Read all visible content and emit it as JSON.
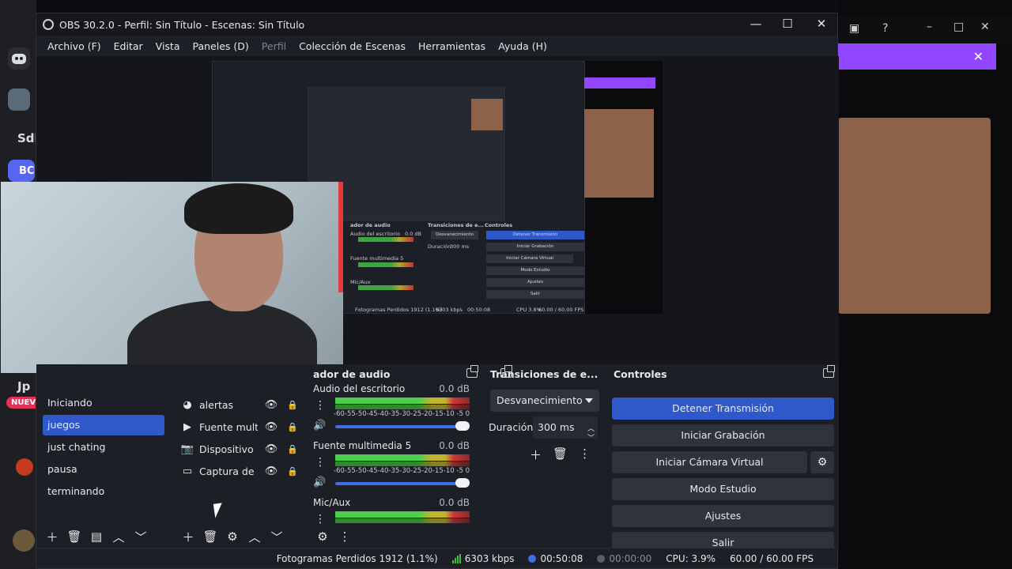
{
  "window": {
    "title": "OBS 30.2.0 - Perfil: Sin Título - Escenas: Sin Título"
  },
  "menu": [
    {
      "label": "Archivo (F)",
      "disabled": false
    },
    {
      "label": "Editar",
      "disabled": false
    },
    {
      "label": "Vista",
      "disabled": false
    },
    {
      "label": "Paneles (D)",
      "disabled": false
    },
    {
      "label": "Perfil",
      "disabled": true
    },
    {
      "label": "Colección de Escenas",
      "disabled": false
    },
    {
      "label": "Herramientas",
      "disabled": false
    },
    {
      "label": "Ayuda (H)",
      "disabled": false
    }
  ],
  "background": {
    "left_text_1": "Sdl",
    "left_text_2": "BC",
    "left_text_3": "Jp",
    "left_badge": "NUEV"
  },
  "scenes": {
    "items": [
      "Iniciando",
      "juegos",
      "just chating",
      "pausa",
      "terminando"
    ],
    "active_index": 1
  },
  "sources": {
    "items": [
      {
        "icon": "alerts-icon",
        "label": "alertas"
      },
      {
        "icon": "play-icon",
        "label": "Fuente mult"
      },
      {
        "icon": "camera-icon",
        "label": "Dispositivo"
      },
      {
        "icon": "monitor-icon",
        "label": "Captura de"
      }
    ]
  },
  "mixer": {
    "header": "ador de audio",
    "channels": [
      {
        "name": "Audio del escritorio",
        "db": "0.0 dB"
      },
      {
        "name": "Fuente multimedia 5",
        "db": "0.0 dB"
      },
      {
        "name": "Mic/Aux",
        "db": "0.0 dB"
      }
    ],
    "scale": "-60-55-50-45-40-35-30-25-20-15-10 -5  0"
  },
  "transitions": {
    "header": "Transiciones de e...",
    "selected": "Desvanecimiento",
    "duration_label": "Duración",
    "duration_value": "300 ms"
  },
  "controls": {
    "header": "Controles",
    "buttons": [
      "Detener Transmisión",
      "Iniciar Grabación",
      "Iniciar Cámara Virtual",
      "Modo Estudio",
      "Ajustes",
      "Salir"
    ]
  },
  "status": {
    "dropped": "Fotogramas Perdidos 1912 (1.1%)",
    "bitrate": "6303 kbps",
    "stream_time": "00:50:08",
    "rec_time": "00:00:00",
    "cpu": "CPU: 3.9%",
    "fps": "60.00 / 60.00 FPS"
  },
  "mini": {
    "buttons": [
      "Detener Transmisión",
      "Iniciar Grabación",
      "Iniciar Cámara Virtual",
      "Modo Estudio",
      "Ajustes",
      "Salir"
    ],
    "status": "Fotogramas Perdidos 1912 (1.1%)",
    "kbps": "6303 kbps",
    "time": "00:50:08",
    "cpu": "CPU 3.8%",
    "fps": "60.00 / 60.00 FPS",
    "controls_header": "Controles",
    "trans_header": "Transiciones de e...",
    "mixer_header": "ador de audio",
    "trans_select": "Desvanecimiento",
    "trans_dur": "Duración",
    "trans_val": "300 ms",
    "ch1": "Audio del escritorio",
    "ch2": "Fuente multimedia 5",
    "ch3": "Mic/Aux",
    "db": "0.0 dB"
  },
  "colors": {
    "accent": "#2f58c9",
    "panel": "#1d1f26",
    "twitch_purple": "#9147ff"
  }
}
